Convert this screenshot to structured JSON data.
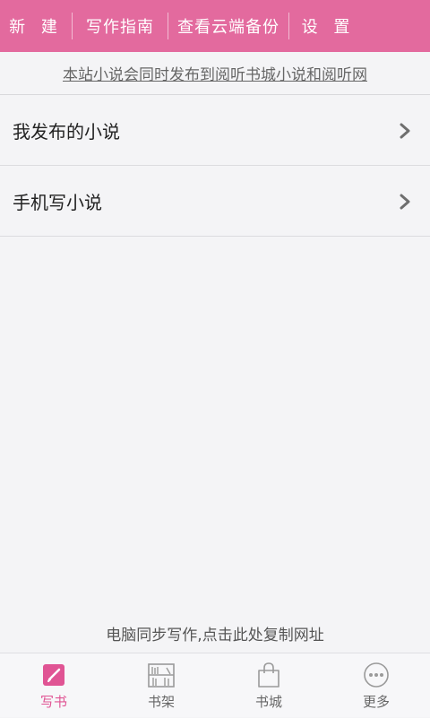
{
  "topbar": {
    "new_label": "新 建",
    "guide_label": "写作指南",
    "backup_label": "查看云端备份",
    "settings_label": "设 置"
  },
  "notice": {
    "text": "本站小说会同时发布到阅听书城小说和阅听网"
  },
  "menu": {
    "items": [
      {
        "label": "我发布的小说",
        "icon": "chevron-right-icon"
      },
      {
        "label": "手机写小说",
        "icon": "chevron-right-icon"
      }
    ]
  },
  "footer": {
    "copy_url_text": "电脑同步写作,点击此处复制网址"
  },
  "bottom_nav": {
    "active_index": 0,
    "items": [
      {
        "label": "写书",
        "icon": "pencil-icon"
      },
      {
        "label": "书架",
        "icon": "bookshelf-icon"
      },
      {
        "label": "书城",
        "icon": "shopping-bag-icon"
      },
      {
        "label": "更多",
        "icon": "more-dots-icon"
      }
    ]
  },
  "colors": {
    "accent": "#e36a9e",
    "active_tab": "#e05494",
    "background": "#f4f4f6"
  }
}
